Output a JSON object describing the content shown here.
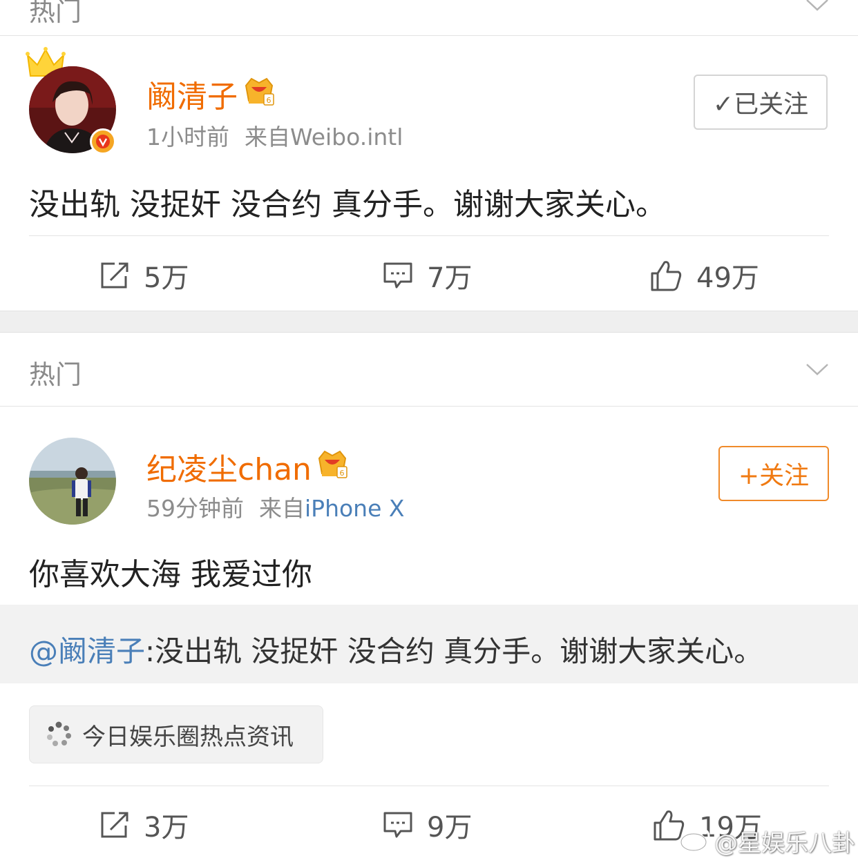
{
  "top_section": {
    "title": "热门"
  },
  "post1": {
    "username": "阚清子",
    "time": "1小时前",
    "source_prefix": "来自",
    "source": "Weibo.intl",
    "follow_button": "✓已关注",
    "text": "没出轨 没捉奸 没合约 真分手。谢谢大家关心。",
    "actions": {
      "repost": "5万",
      "comment": "7万",
      "like": "49万"
    }
  },
  "section2": {
    "title": "热门"
  },
  "post2": {
    "username": "纪凌尘chan",
    "time": "59分钟前",
    "source_prefix": "来自",
    "source": "iPhone X",
    "follow_button": "+关注",
    "text": "你喜欢大海 我爱过你",
    "repost": {
      "mention": "@阚清子",
      "text": ":没出轨 没捉奸 没合约 真分手。谢谢大家关心。"
    },
    "topic": "今日娱乐圈热点资讯",
    "actions": {
      "repost": "3万",
      "comment": "9万",
      "like": "19万"
    }
  },
  "watermark": "@星娱乐八卦",
  "colors": {
    "username": "#f06c00",
    "link": "#4a7fb8",
    "follow": "#f07a12"
  }
}
